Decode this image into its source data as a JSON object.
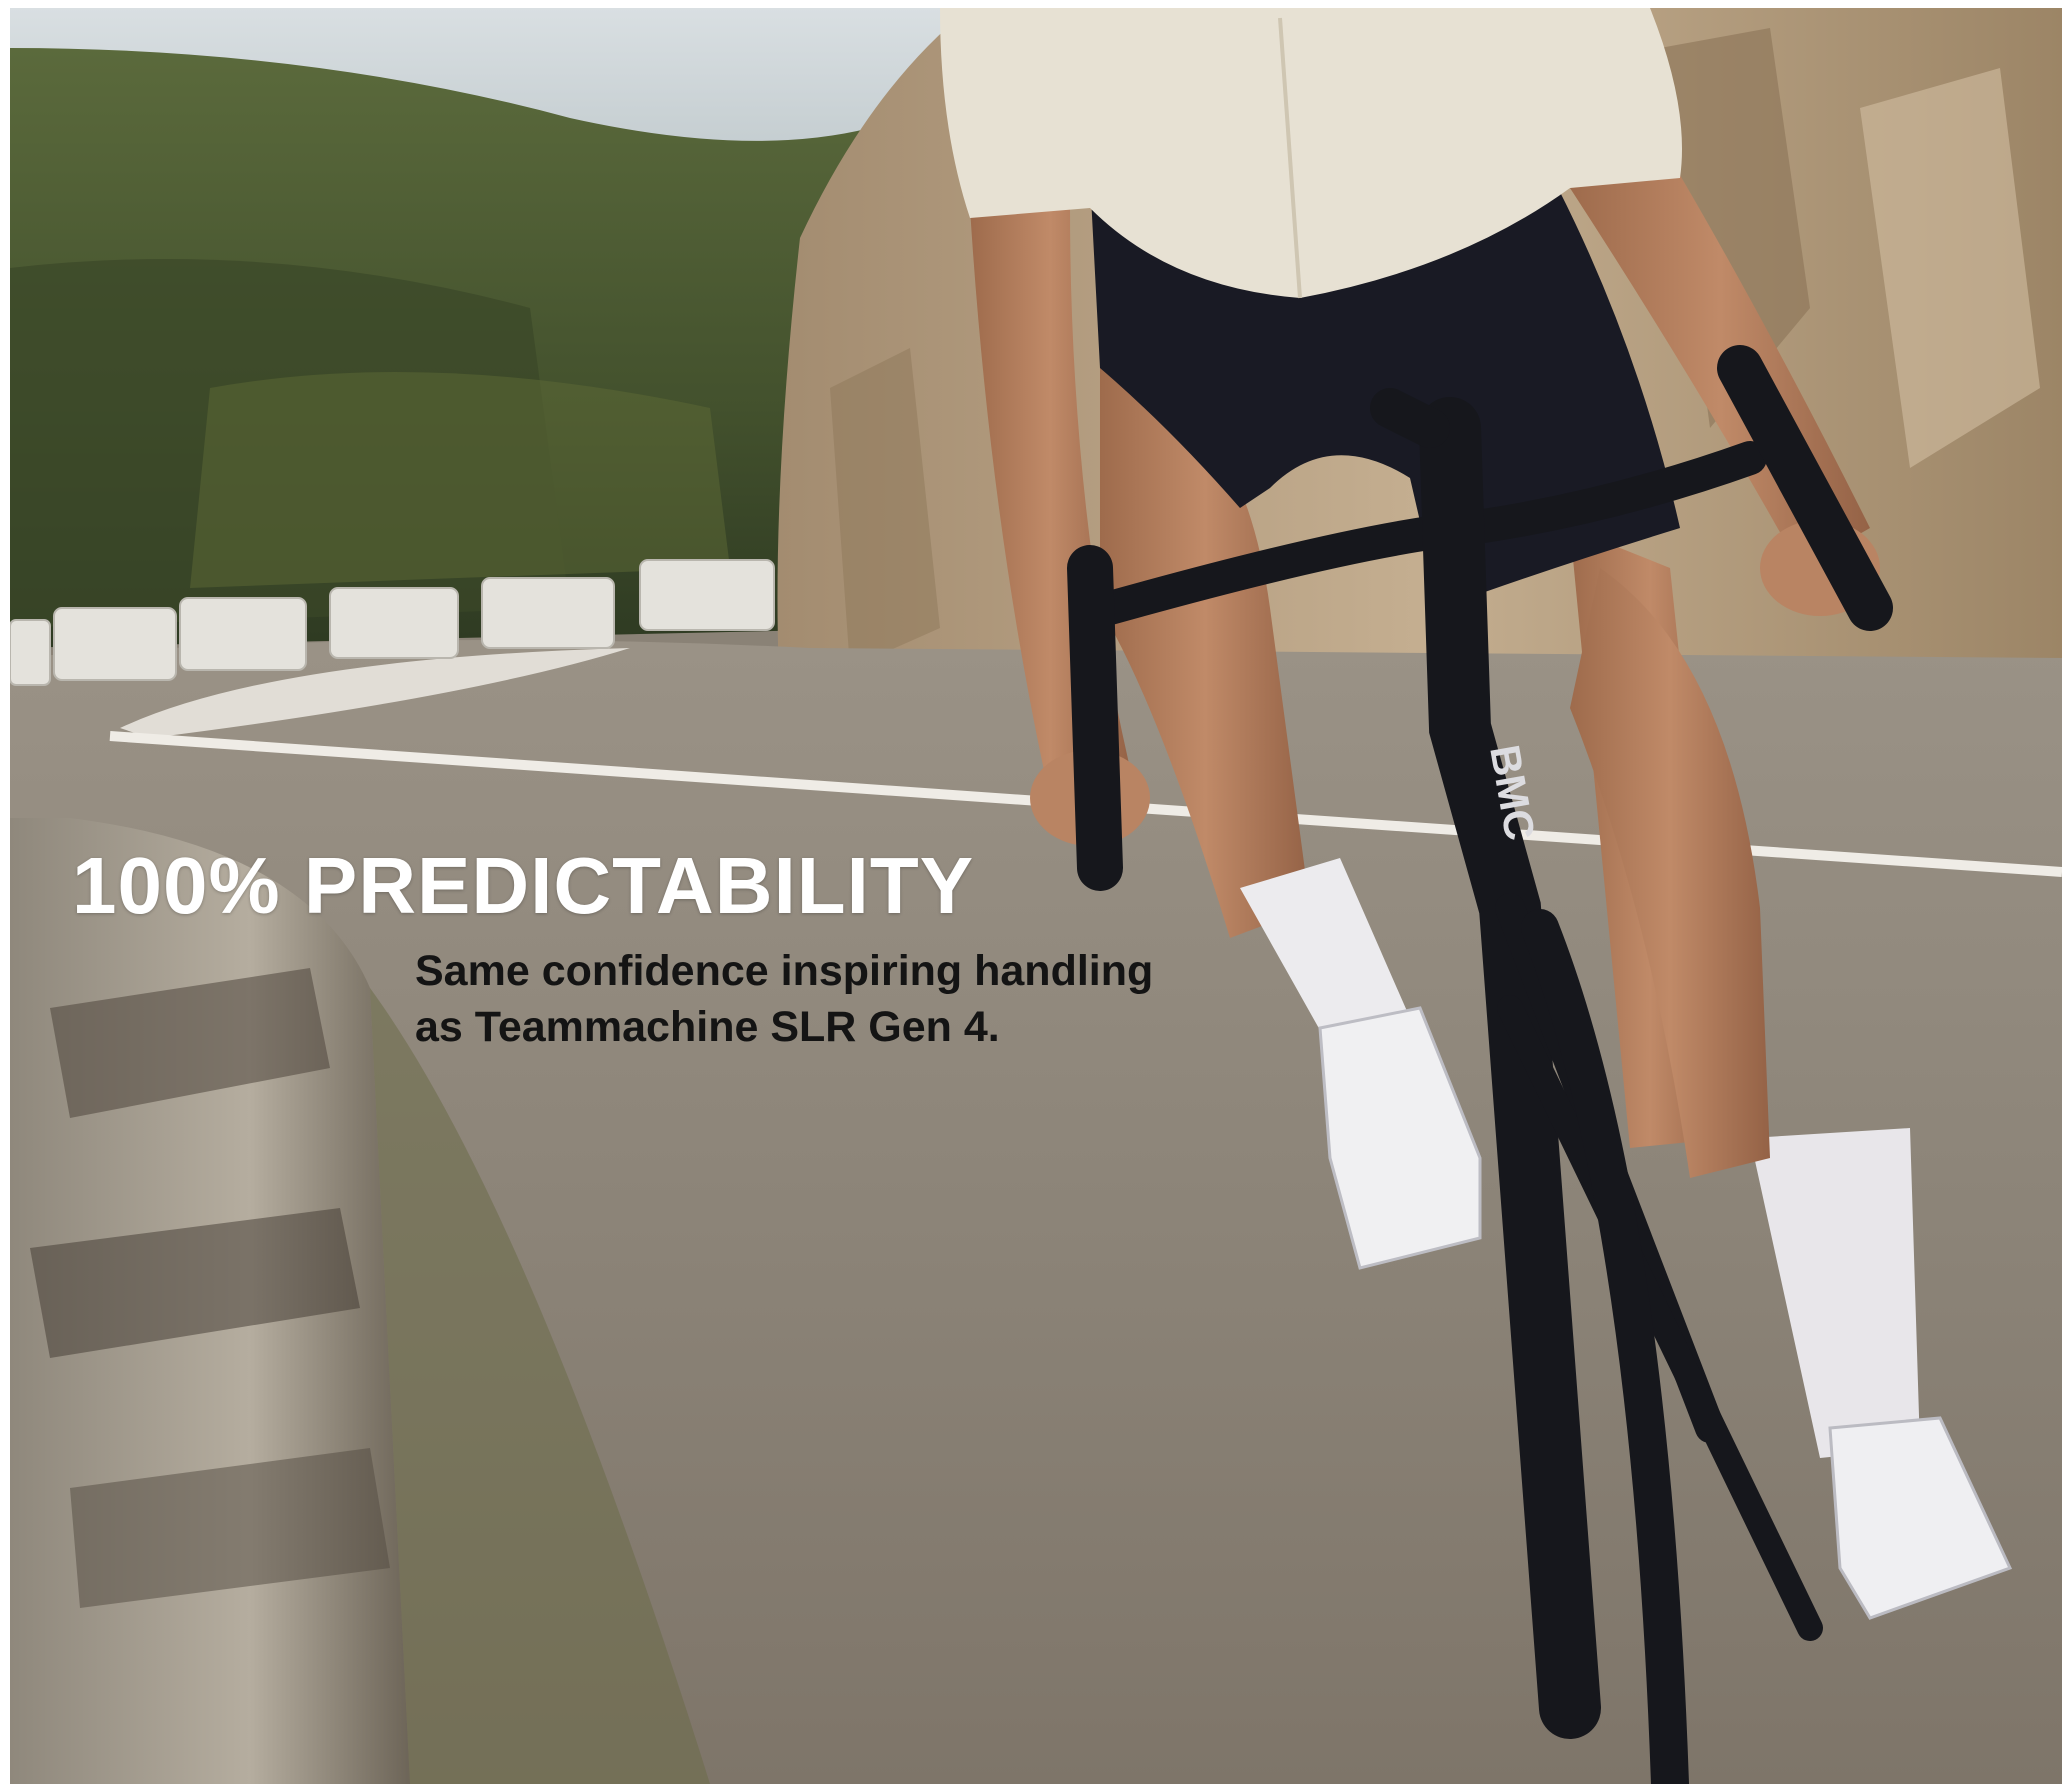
{
  "hero": {
    "headline": "100% PREDICTABILITY",
    "subtext_line1": "Same confidence inspiring handling",
    "subtext_line2": "as Teammachine SLR Gen 4.",
    "frame_brand": "BMC"
  },
  "colors": {
    "sky": "#c9d2d6",
    "hillside": "#4c5a33",
    "rock": "#b39c80",
    "road": "#8d857a",
    "jersey": "#e7e1d3",
    "shorts": "#191a24",
    "skin": "#b07a5a",
    "bike": "#16171c",
    "headline_text": "#ffffff",
    "subtext_text": "#141414"
  }
}
